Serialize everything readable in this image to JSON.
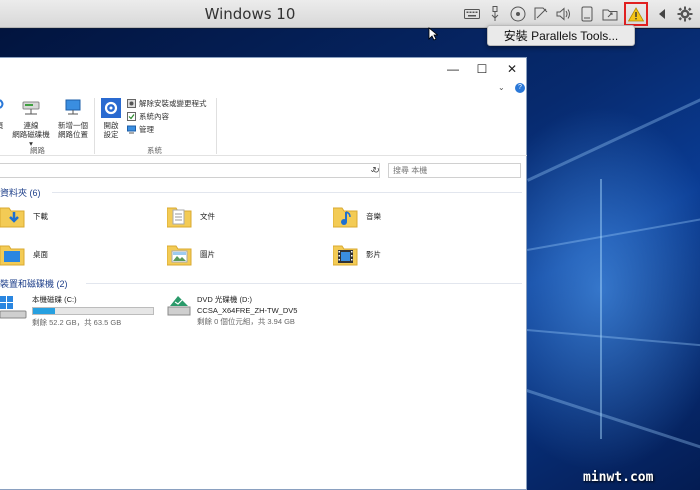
{
  "mac": {
    "title": "Windows 10",
    "menu_item": "安裝 Parallels Tools..."
  },
  "ribbon": {
    "left_items": [
      "頁",
      "連線\n網路磁碟機▾",
      "新增一個\n網路位置"
    ],
    "network_group": "網路",
    "open_settings": "開啟\n設定",
    "uninstall": "解除安裝或變更程式",
    "system_props": "系統內容",
    "manage": "管理",
    "system_group": "系統"
  },
  "search": {
    "placeholder": "搜尋 本機"
  },
  "folders": {
    "title": "資料夾 (6)",
    "items": [
      {
        "label": "下載",
        "icon": "downloads-folder-icon"
      },
      {
        "label": "文件",
        "icon": "documents-folder-icon"
      },
      {
        "label": "音樂",
        "icon": "music-folder-icon"
      },
      {
        "label": "桌面",
        "icon": "desktop-folder-icon"
      },
      {
        "label": "圖片",
        "icon": "pictures-folder-icon"
      },
      {
        "label": "影片",
        "icon": "videos-folder-icon"
      }
    ]
  },
  "drives": {
    "title": "裝置和磁碟機 (2)",
    "c": {
      "name": "本機磁碟 (C:)",
      "free": "剩餘 52.2 GB，共 63.5 GB",
      "used_fraction": 0.18
    },
    "d": {
      "name": "DVD 光碟機 (D:)",
      "label": "CCSA_X64FRE_ZH-TW_DV5",
      "free": "剩餘 0 個位元組，共 3.94 GB"
    }
  },
  "watermark": "minwt.com",
  "colors": {
    "warning": "#f5c518",
    "highlight": "#e02020",
    "accent": "#27a0e0",
    "section": "#1e3f8a"
  }
}
